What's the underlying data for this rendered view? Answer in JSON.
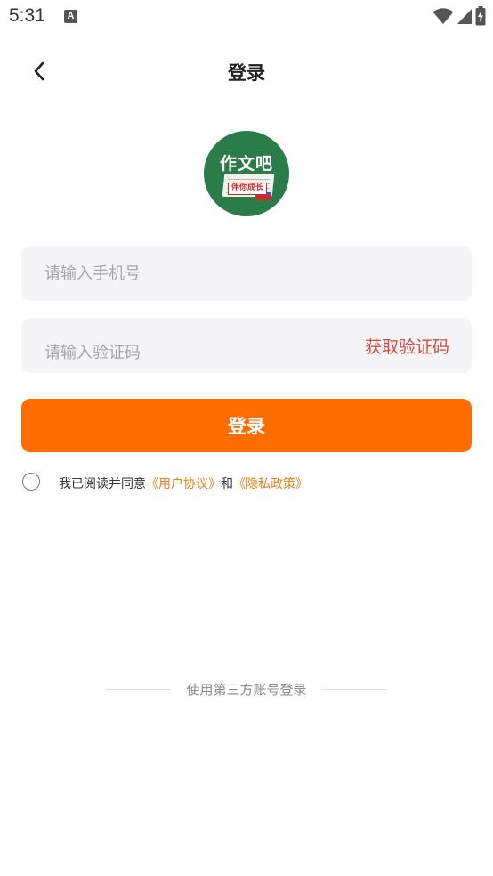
{
  "status_bar": {
    "time": "5:31",
    "notification_icon": "a-icon",
    "wifi_icon": "wifi-icon",
    "signal_icon": "signal-icon",
    "battery_icon": "battery-charging-icon"
  },
  "header": {
    "back_icon": "chevron-left-icon",
    "title": "登录"
  },
  "logo": {
    "title": "作文吧",
    "ribbon": "伴你成长",
    "colors": {
      "background": "#2a7d48",
      "ribbon": "#cf2b2b"
    }
  },
  "form": {
    "phone_placeholder": "请输入手机号",
    "phone_value": "",
    "code_placeholder": "请输入验证码",
    "code_value": "",
    "get_code_label": "获取验证码",
    "login_label": "登录"
  },
  "agreement": {
    "prefix": "我已阅读并同意",
    "user_agreement": "《用户协议》",
    "conjunction": "和",
    "privacy_policy": "《隐私政策》",
    "checked": false
  },
  "third_party": {
    "label": "使用第三方账号登录"
  },
  "colors": {
    "accent": "#ff6d00",
    "link": "#f07f1a",
    "get_code": "#d44a45",
    "field_bg": "#f5f5f7"
  }
}
